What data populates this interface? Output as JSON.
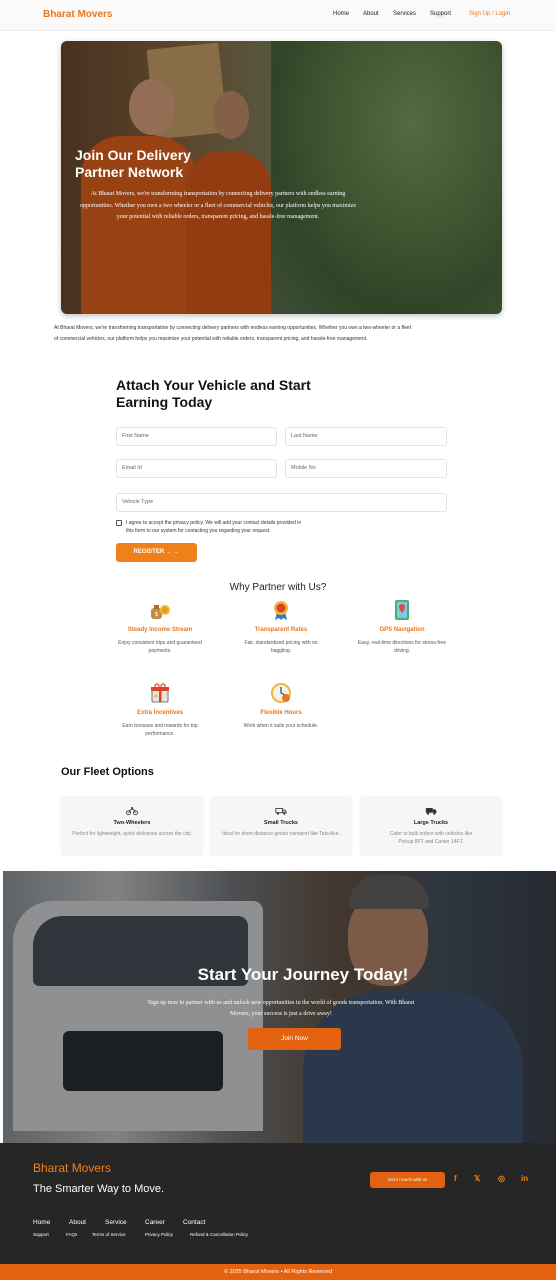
{
  "nav": {
    "brand": "Bharat Movers",
    "links": [
      "Home",
      "About",
      "Services",
      "Support"
    ],
    "signup": "Sign Up / Login"
  },
  "hero": {
    "title": "Join Our Delivery Partner Network",
    "text": "At Bharat Movers, we're transforming transportation by connecting delivery partners with endless earning opportunities. Whether you own a two wheeler or a fleet of commercial vehicles, our platform helps you maximize your potential with reliable orders, transparent pricing, and hassle-free management."
  },
  "intro": "At Bharat Movers, we're transforming transportation by connecting delivery partners with endless earning opportunities. Whether you own a two-wheeler or a fleet of commercial vehicles, our platform helps you maximize your potential with reliable orders, transparent pricing, and hassle-free management.",
  "form": {
    "title": "Attach Your Vehicle and Start Earning Today",
    "first_name": "First Name",
    "last_name": "Last Name",
    "email": "Email Id",
    "mobile": "Mobile No",
    "vehicle_type": "Vehicle Type",
    "consent": "I agree to accept the privacy policy. We will add your contact details provided in this form to our system for contacting you regarding your request.",
    "register": "REGISTER → →"
  },
  "why": {
    "title": "Why Partner with Us?",
    "features": [
      {
        "name": "Steady Income Stream",
        "desc": "Enjoy consistent trips and guaranteed payments.",
        "icon": "money-bag-icon"
      },
      {
        "name": "Transparent Rates",
        "desc": "Fair, standardized pricing with no haggling.",
        "icon": "award-medal-icon"
      },
      {
        "name": "GPS Navigation",
        "desc": "Easy, real-time directions for stress-free driving.",
        "icon": "map-pin-icon"
      },
      {
        "name": "Extra Incentives",
        "desc": "Earn bonuses and rewards for top performance.",
        "icon": "gift-icon"
      },
      {
        "name": "Flexible Hours",
        "desc": "Work when it suits your schedule.",
        "icon": "clock-icon"
      }
    ]
  },
  "fleet": {
    "title": "Our Fleet Options",
    "cards": [
      {
        "name": "Two-Wheelers",
        "desc": "Perfect for lightweight, quick deliveries across the city.",
        "icon": "motorcycle-icon"
      },
      {
        "name": "Small Trucks",
        "desc": "Ideal for short-distance goods transport like Tata Ace.",
        "icon": "small-truck-icon"
      },
      {
        "name": "Large Trucks",
        "desc": "Cater to bulk orders with vehicles like Pickup 8FT and Canter 14FT.",
        "icon": "large-truck-icon"
      }
    ]
  },
  "cta": {
    "title": "Start Your Journey Today!",
    "text": "Sign up now to partner with us and unlock new opportunities in the world of goods transportation. With Bharat Movers, your success is just a drive away!",
    "button": "Join Now"
  },
  "footer": {
    "brand": "Bharat Movers",
    "tagline": "The Smarter Way to Move.",
    "contact": "Get in touch with us",
    "social": {
      "facebook": "f",
      "x": "𝕏",
      "instagram": "◎",
      "linkedin": "in"
    },
    "links": [
      "Home",
      "About",
      "Service",
      "Career",
      "Contact"
    ],
    "sub_links": [
      "Support",
      "FAQs",
      "Terms of Service",
      "Privacy Policy",
      "Refund & Cancellation Policy"
    ],
    "copyright": "© 2025 Bharat Movers • All Rights Reserved"
  },
  "colors": {
    "accent": "#e8771e",
    "button": "#f08019",
    "footer_bg": "#262626",
    "cta_button": "#e4620f"
  }
}
